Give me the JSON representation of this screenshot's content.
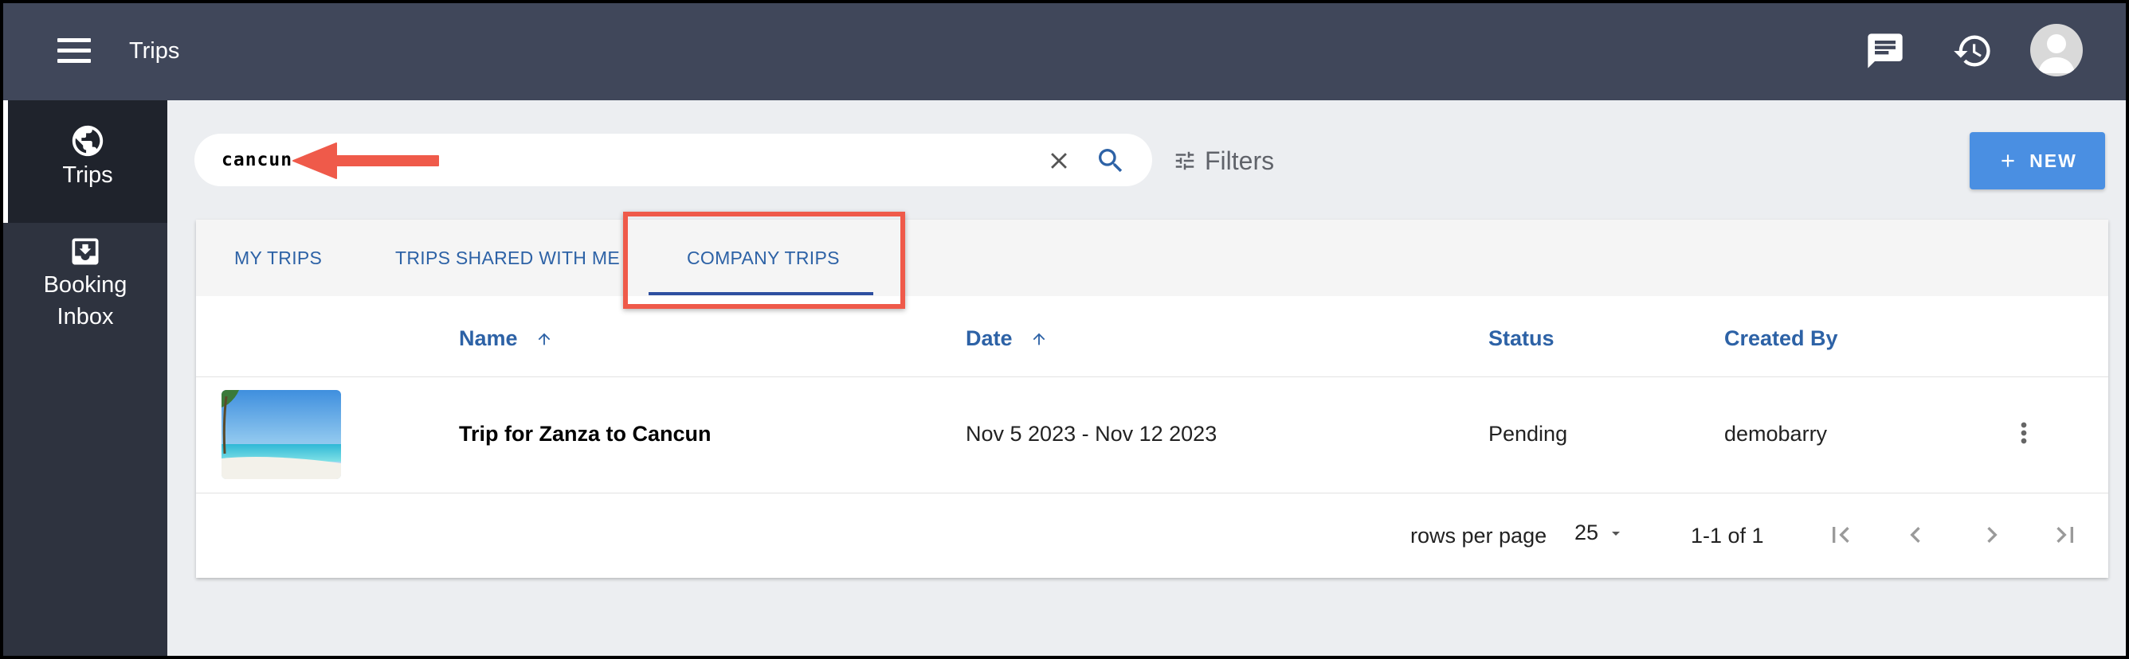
{
  "header": {
    "title": "Trips"
  },
  "sidebar": {
    "items": [
      {
        "label": "Trips",
        "icon": "globe-icon"
      },
      {
        "label_line1": "Booking",
        "label_line2": "Inbox",
        "icon": "inbox-download-icon"
      }
    ]
  },
  "search": {
    "value": "cancun",
    "placeholder": ""
  },
  "toolbar": {
    "filters_label": "Filters",
    "new_label": "NEW"
  },
  "tabs": [
    {
      "label": "MY TRIPS",
      "active": false
    },
    {
      "label": "TRIPS SHARED WITH ME",
      "active": false
    },
    {
      "label": "COMPANY TRIPS",
      "active": true
    }
  ],
  "table": {
    "columns": [
      "Name",
      "Date",
      "Status",
      "Created By"
    ],
    "rows": [
      {
        "name": "Trip for Zanza to Cancun",
        "date": "Nov 5 2023 - Nov 12 2023",
        "status": "Pending",
        "created_by": "demobarry"
      }
    ]
  },
  "pagination": {
    "rows_per_page_label": "rows per page",
    "rows_per_page_value": "25",
    "range_text": "1-1 of 1"
  },
  "colors": {
    "topbar": "#40475a",
    "sidebar": "#2e333f",
    "accent": "#2d62a6",
    "new_button": "#4a8fe2",
    "annotation": "#ef5a4a"
  }
}
